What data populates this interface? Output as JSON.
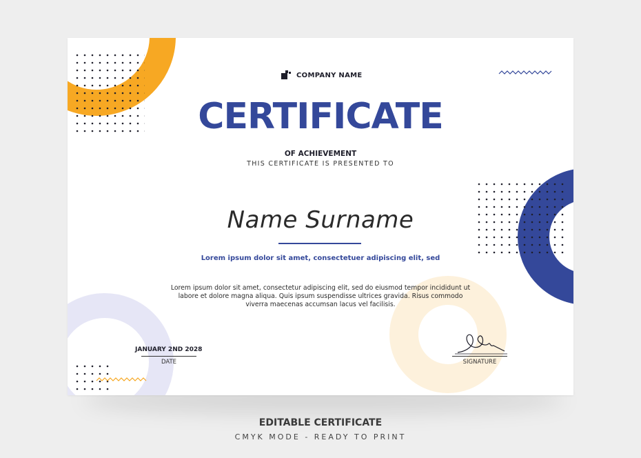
{
  "certificate": {
    "company_name": "COMPANY NAME",
    "title": "CERTIFICATE",
    "subtitle": "OF ACHIEVEMENT",
    "presented_to": "THIS CERTIFICATE IS PRESENTED TO",
    "recipient_name": "Name Surname",
    "lead_text": "Lorem ipsum dolor sit amet, consectetuer adipiscing elit, sed",
    "body_lines": [
      "Lorem ipsum dolor sit amet, consectetur adipiscing elit, sed do eiusmod tempor incididunt ut",
      "labore et dolore magna aliqua. Quis ipsum suspendisse ultrices gravida. Risus commodo",
      "viverra maecenas accumsan lacus vel facilisis."
    ],
    "date_value": "JANUARY 2ND 2028",
    "date_label": "DATE",
    "signature_label": "SIGNATURE"
  },
  "footer": {
    "title": "EDITABLE CERTIFICATE",
    "subtitle": "CMYK MODE - READY TO PRINT"
  },
  "colors": {
    "primary_blue": "#34489a",
    "accent_orange": "#f7a823",
    "lavender": "#e4e4f5",
    "cream": "#fdf1dc",
    "background": "#eeeeee"
  }
}
